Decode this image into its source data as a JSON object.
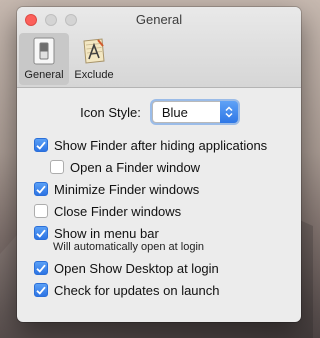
{
  "window": {
    "title": "General"
  },
  "toolbar": {
    "tabs": [
      {
        "label": "General",
        "icon": "switch-icon",
        "selected": true
      },
      {
        "label": "Exclude",
        "icon": "app-icon",
        "selected": false
      }
    ]
  },
  "icon_style": {
    "label": "Icon Style:",
    "value": "Blue"
  },
  "options": [
    {
      "label": "Show Finder after hiding applications",
      "checked": true
    },
    {
      "label": "Open a Finder window",
      "checked": false
    },
    {
      "label": "Minimize Finder windows",
      "checked": true
    },
    {
      "label": "Close Finder windows",
      "checked": false
    },
    {
      "label": "Show in menu bar",
      "checked": true
    },
    {
      "label": "Open Show Desktop at login",
      "checked": true
    },
    {
      "label": "Check for updates on launch",
      "checked": true
    }
  ],
  "menu_bar_note": "Will automatically open at login",
  "colors": {
    "accent": "#2d74e4",
    "close": "#fc605b"
  }
}
